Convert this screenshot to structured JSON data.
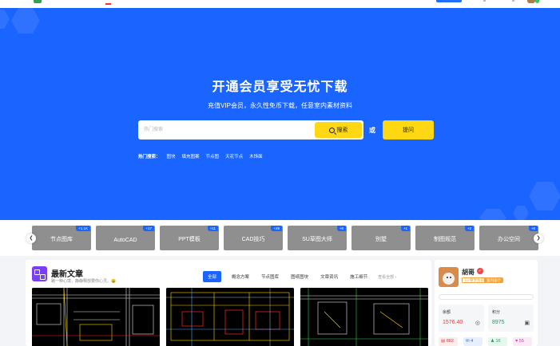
{
  "hero": {
    "title": "开通会员享受无忧下载",
    "subtitle": "充值VIP会员，永久性免币下载，任意室内素材资料",
    "search_placeholder": "热门搜索",
    "search_label": "搜索",
    "or_label": "或",
    "ask_label": "提问",
    "hot_label": "热门搜索：",
    "hot_tags": [
      "图块",
      "填充图案",
      "节点图",
      "天花节点",
      "木饰面"
    ]
  },
  "categories": [
    {
      "label": "节点图库",
      "badge": "+1.1K"
    },
    {
      "label": "AutoCAD",
      "badge": "+17"
    },
    {
      "label": "PPT模板",
      "badge": "+11"
    },
    {
      "label": "CAD技巧",
      "badge": "+29"
    },
    {
      "label": "SU草图大师",
      "badge": "+0"
    },
    {
      "label": "别墅",
      "badge": "+1"
    },
    {
      "label": "制图规范",
      "badge": "+2"
    },
    {
      "label": "办公空间",
      "badge": "+0"
    }
  ],
  "articles": {
    "title": "最新文章",
    "subtitle": "路一种心境，静静释放要你心灵。😀",
    "tabs": [
      "全部",
      "概念方案",
      "节点图库",
      "图纸图块",
      "文章资讯",
      "施工细节"
    ],
    "more": "查看全部 ›"
  },
  "user": {
    "name": "胡哥",
    "badge_level": "Lv 尊贵会员",
    "badge_tag": "室内设计",
    "balance_label": "余额",
    "balance_value": "1576.40",
    "points_label": "积分",
    "points_value": "8975",
    "counters": [
      "882",
      "4",
      "16",
      "55"
    ]
  },
  "colors": {
    "brand_blue": "#1a64ff",
    "accent_yellow": "#ffd814",
    "balance_red": "#e43c3c",
    "points_green": "#1aa260"
  }
}
